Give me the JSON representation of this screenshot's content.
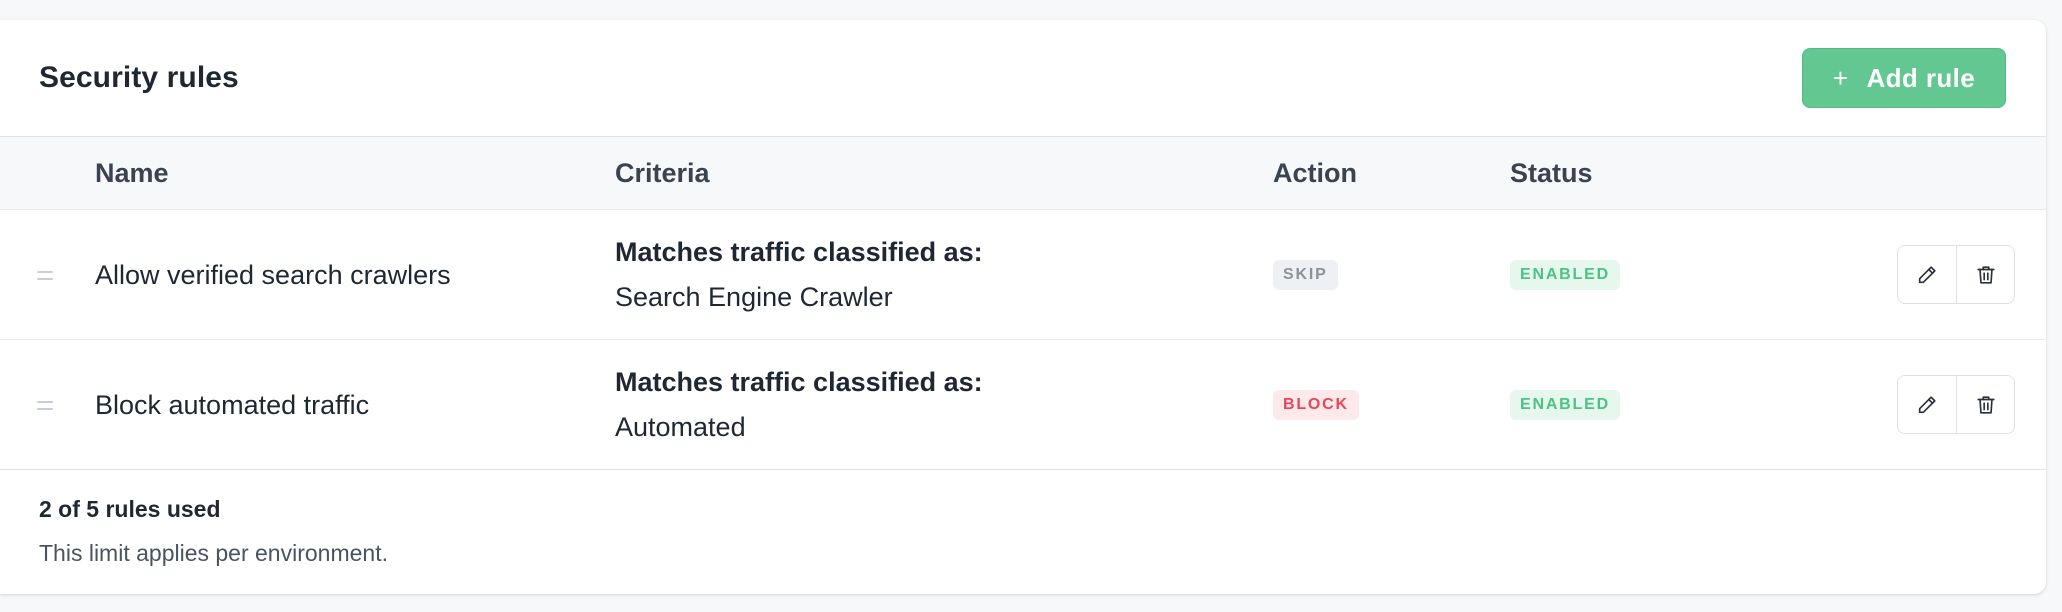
{
  "header": {
    "title": "Security rules",
    "add_button": {
      "icon": "plus-icon",
      "glyph": "+",
      "label": "Add rule"
    }
  },
  "table": {
    "columns": [
      "Name",
      "Criteria",
      "Action",
      "Status"
    ],
    "rows": [
      {
        "name": "Allow verified search crawlers",
        "criteria_label": "Matches traffic classified as:",
        "criteria_value": "Search Engine Crawler",
        "action": "SKIP",
        "status": "ENABLED"
      },
      {
        "name": "Block automated traffic",
        "criteria_label": "Matches traffic classified as:",
        "criteria_value": "Automated",
        "action": "BLOCK",
        "status": "ENABLED"
      }
    ],
    "row_icons": {
      "drag": "drag-handle-icon",
      "edit": "pencil-icon",
      "delete": "trash-icon"
    }
  },
  "footer": {
    "usage": "2 of 5 rules used",
    "note": "This limit applies per environment."
  },
  "colors": {
    "accent": "#63c792",
    "skip_badge": "#8a929d",
    "block_badge": "#e5485b",
    "enabled_badge": "#4cc283"
  }
}
